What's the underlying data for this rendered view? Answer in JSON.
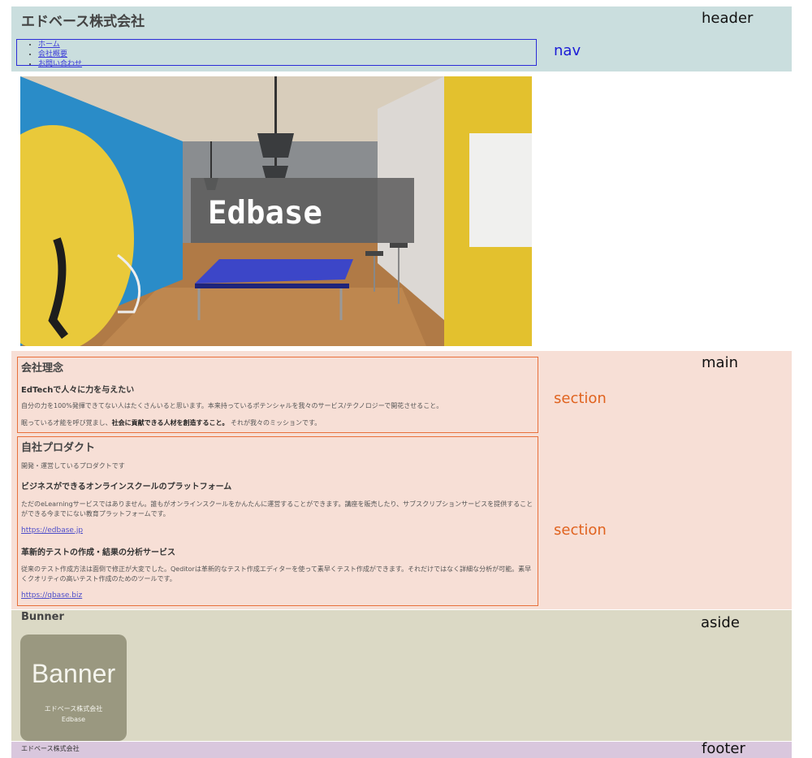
{
  "header": {
    "site_title": "エドベース株式会社",
    "region_label": "header"
  },
  "nav": {
    "region_label": "nav",
    "links": [
      "ホーム",
      "会社概要",
      "お問い合わせ"
    ]
  },
  "hero": {
    "title": "Edbase"
  },
  "main": {
    "region_label": "main",
    "section_label": "section",
    "philosophy": {
      "heading": "会社理念",
      "subheading": "EdTechで人々に力を与えたい",
      "para1": "自分の力を100%発揮できてない人はたくさんいると思います。本来持っているポテンシャルを我々のサービス/テクノロジーで開花させること。",
      "para2_before": "眠っている才能を呼び覚まし、",
      "para2_strong": "社会に貢献できる人材を創造すること。",
      "para2_after": " それが我々のミッションです。"
    },
    "products": {
      "heading": "自社プロダクト",
      "intro": "開発・運営しているプロダクトです",
      "p1_title": "ビジネスができるオンラインスクールのプラットフォーム",
      "p1_desc": "ただのeLearningサービスではありません。誰もがオンラインスクールをかんたんに運営することができます。講座を販売したり、サブスクリプションサービスを提供することができる今までにない教育プラットフォームです。",
      "p1_link": "https://edbase.jp",
      "p2_title": "革新的テストの作成・結果の分析サービス",
      "p2_desc": "従来のテスト作成方法は面倒で修正が大変でした。Qeditorは革新的なテスト作成エディターを使って素早くテスト作成ができます。それだけではなく詳細な分析が可能。素早くクオリティの高いテスト作成のためのツールです。",
      "p2_link": "https://qbase.biz"
    }
  },
  "aside": {
    "region_label": "aside",
    "title": "Bunner",
    "banner_big": "Banner",
    "banner_line1": "エドベース株式会社",
    "banner_line2": "Edbase"
  },
  "footer": {
    "region_label": "footer",
    "text": "エドベース株式会社"
  }
}
